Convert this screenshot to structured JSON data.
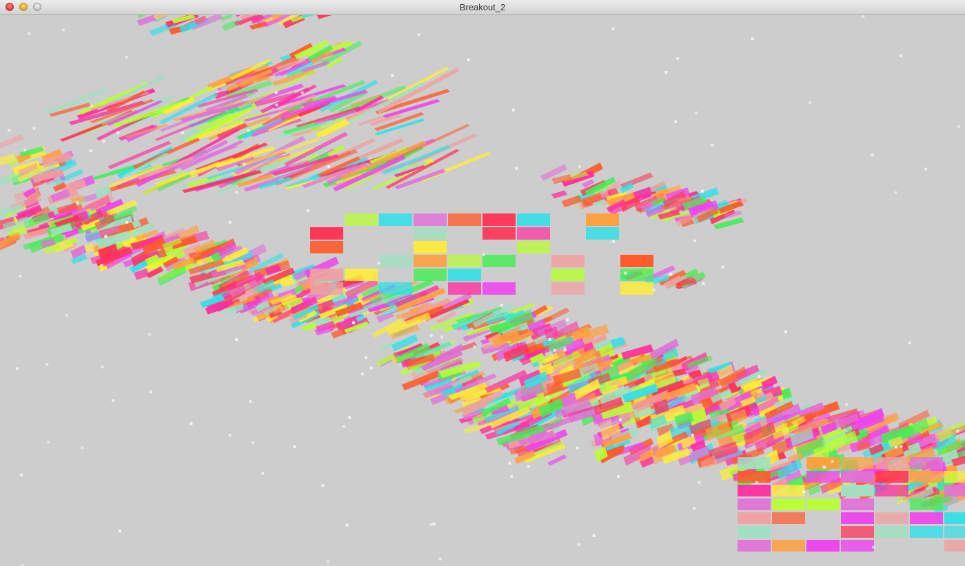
{
  "window": {
    "title": "Breakout_2",
    "controls": {
      "close": "close-button",
      "minimize": "minimize-button",
      "zoom": "zoom-button"
    }
  },
  "scene": {
    "background": "#cdcdcd",
    "palette": [
      "#ff2fa0",
      "#ee44ee",
      "#e070d8",
      "#ff3355",
      "#ff5a2a",
      "#ffa040",
      "#ffee33",
      "#b8ff30",
      "#44ee55",
      "#33e0e8",
      "#a0e0c0",
      "#f0a0a0"
    ],
    "description_items": [
      "brick-wall-front",
      "brick-wall-bottom-right",
      "brick-streaks"
    ]
  }
}
